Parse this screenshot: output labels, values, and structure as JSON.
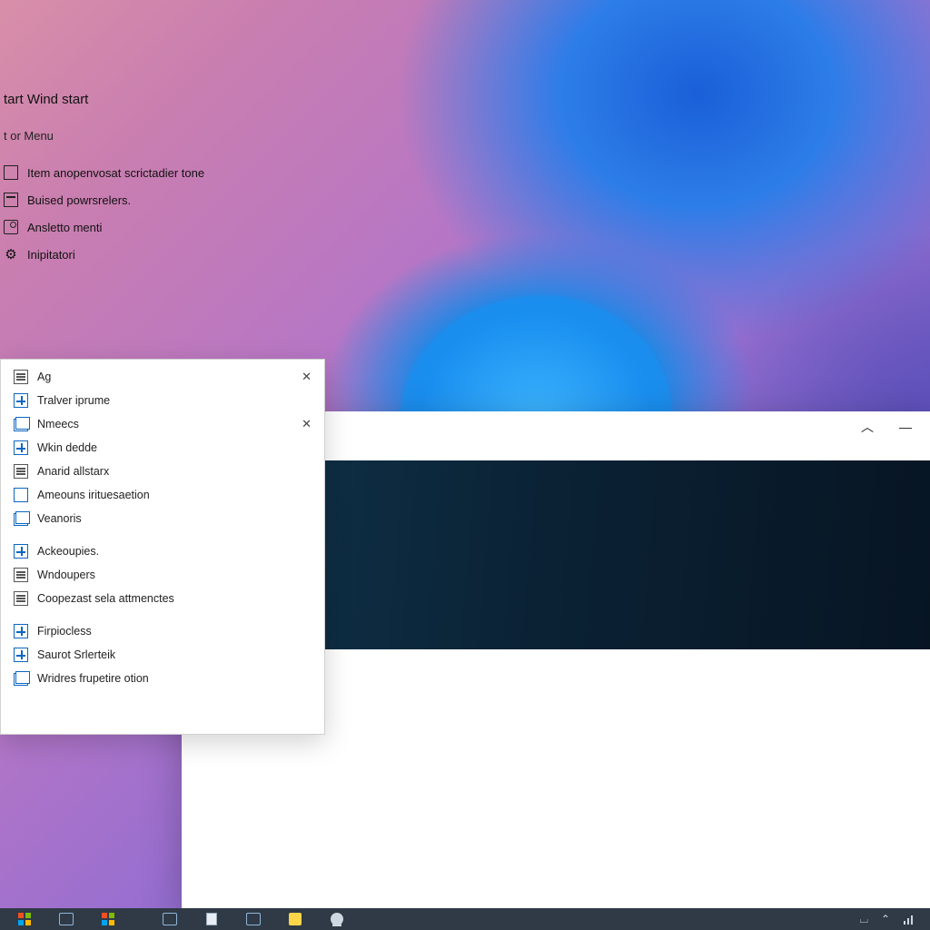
{
  "start": {
    "title": "tart Wind start",
    "subtitle": "t or Menu",
    "items": [
      {
        "icon": "list-icon",
        "label": "Item anopenvosat scrictadier tone"
      },
      {
        "icon": "calendar-icon",
        "label": "Buised powrsrelers."
      },
      {
        "icon": "disk-icon",
        "label": "Ansletto menti"
      },
      {
        "icon": "gear-icon",
        "label": "Inipitatori"
      }
    ]
  },
  "apps": {
    "items": [
      {
        "icon": "letter-icon",
        "label": "Ag",
        "closable": true
      },
      {
        "icon": "grid-icon",
        "label": "Tralver iprume",
        "closable": false
      },
      {
        "icon": "building-icon",
        "label": "Nmeecs",
        "closable": true
      },
      {
        "icon": "chart-icon",
        "label": "Wkin dedde",
        "closable": false
      },
      {
        "icon": "doc-icon",
        "label": "Anarid allstarx",
        "closable": false
      },
      {
        "icon": "square-icon",
        "label": "Ameouns irituesaetion",
        "closable": false
      },
      {
        "icon": "stack-icon",
        "label": "Veanoris",
        "closable": false
      },
      {
        "icon": "list2-icon",
        "label": "Ackeoupies.",
        "closable": false,
        "gapBefore": true
      },
      {
        "icon": "doc-icon",
        "label": "Wndoupers",
        "closable": false
      },
      {
        "icon": "blank-icon",
        "label": "Coopezast sela attmenctes",
        "closable": false
      },
      {
        "icon": "grid-icon",
        "label": "Firpiocless",
        "closable": false,
        "gapBefore": true
      },
      {
        "icon": "grid-icon",
        "label": "Saurot Srlerteik",
        "closable": false
      },
      {
        "icon": "stack-icon",
        "label": "Wridres frupetire otion",
        "closable": false
      }
    ]
  },
  "window": {
    "minimize_tip": "Collapse",
    "maximize_tip": "Minimize"
  },
  "taskbar": {
    "items": [
      "start",
      "mail",
      "windows",
      "gap",
      "folder",
      "doc",
      "browser",
      "notes",
      "people"
    ],
    "tray": [
      "underline",
      "up",
      "net"
    ]
  }
}
